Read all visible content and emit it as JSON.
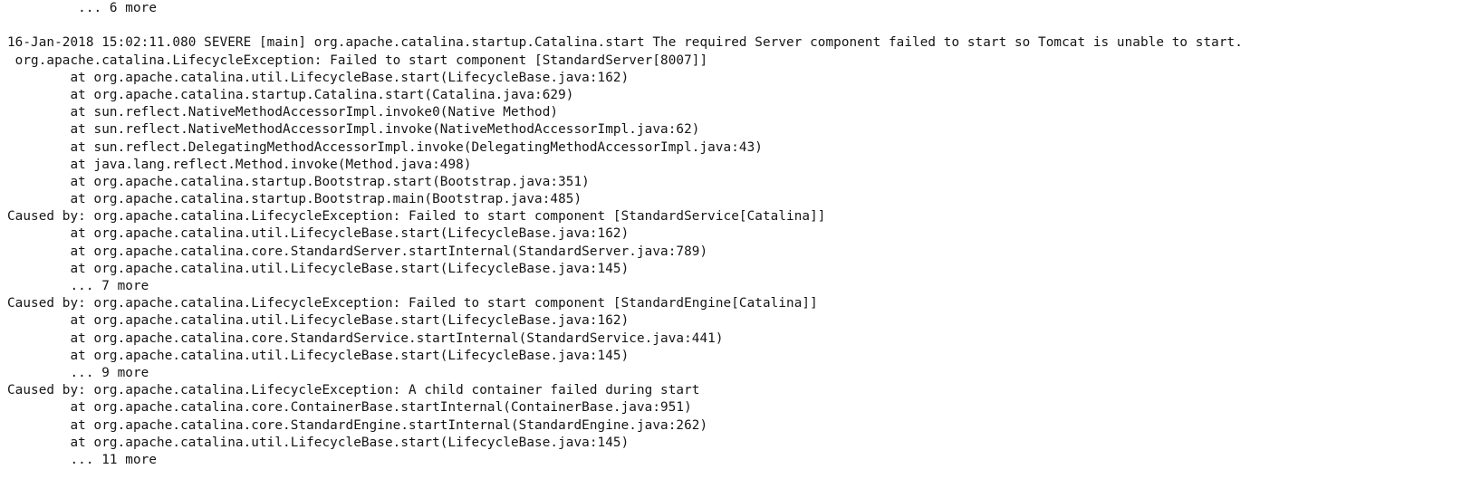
{
  "document": {
    "type": "plain-text-log",
    "title": "Apache Tomcat Catalina startup error stack trace",
    "background_color": "#ffffff",
    "text_color": "#141414",
    "font_kind": "monospace",
    "line_count": 26,
    "timestamp": "16-Jan-2018 15:02:11.080",
    "severity": "SEVERE",
    "thread": "[main]",
    "logger": "org.apache.catalina.startup.Catalina.start",
    "message": "The required Server component failed to start so Tomcat is unable to start.",
    "lines": [
      "         ... 6 more",
      "",
      "16-Jan-2018 15:02:11.080 SEVERE [main] org.apache.catalina.startup.Catalina.start The required Server component failed to start so Tomcat is unable to start.",
      " org.apache.catalina.LifecycleException: Failed to start component [StandardServer[8007]]",
      "        at org.apache.catalina.util.LifecycleBase.start(LifecycleBase.java:162)",
      "        at org.apache.catalina.startup.Catalina.start(Catalina.java:629)",
      "        at sun.reflect.NativeMethodAccessorImpl.invoke0(Native Method)",
      "        at sun.reflect.NativeMethodAccessorImpl.invoke(NativeMethodAccessorImpl.java:62)",
      "        at sun.reflect.DelegatingMethodAccessorImpl.invoke(DelegatingMethodAccessorImpl.java:43)",
      "        at java.lang.reflect.Method.invoke(Method.java:498)",
      "        at org.apache.catalina.startup.Bootstrap.start(Bootstrap.java:351)",
      "        at org.apache.catalina.startup.Bootstrap.main(Bootstrap.java:485)",
      "Caused by: org.apache.catalina.LifecycleException: Failed to start component [StandardService[Catalina]]",
      "        at org.apache.catalina.util.LifecycleBase.start(LifecycleBase.java:162)",
      "        at org.apache.catalina.core.StandardServer.startInternal(StandardServer.java:789)",
      "        at org.apache.catalina.util.LifecycleBase.start(LifecycleBase.java:145)",
      "        ... 7 more",
      "Caused by: org.apache.catalina.LifecycleException: Failed to start component [StandardEngine[Catalina]]",
      "        at org.apache.catalina.util.LifecycleBase.start(LifecycleBase.java:162)",
      "        at org.apache.catalina.core.StandardService.startInternal(StandardService.java:441)",
      "        at org.apache.catalina.util.LifecycleBase.start(LifecycleBase.java:145)",
      "        ... 9 more",
      "Caused by: org.apache.catalina.LifecycleException: A child container failed during start",
      "        at org.apache.catalina.core.ContainerBase.startInternal(ContainerBase.java:951)",
      "        at org.apache.catalina.core.StandardEngine.startInternal(StandardEngine.java:262)",
      "        at org.apache.catalina.util.LifecycleBase.start(LifecycleBase.java:145)",
      "        ... 11 more"
    ]
  }
}
